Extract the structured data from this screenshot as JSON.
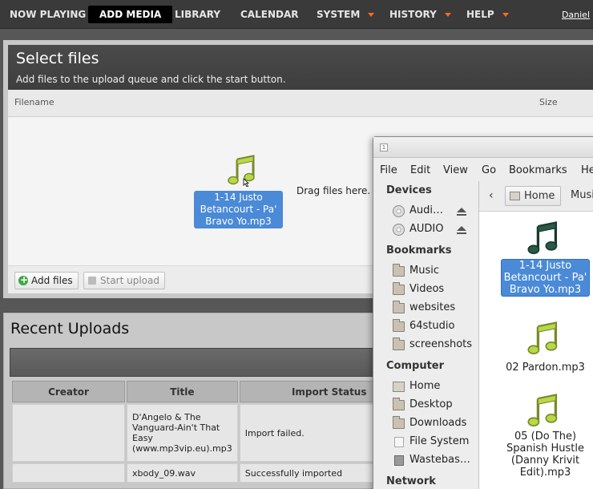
{
  "nav": {
    "items": [
      {
        "label": "NOW PLAYING",
        "dropdown": false
      },
      {
        "label": "ADD MEDIA",
        "dropdown": false,
        "active": true
      },
      {
        "label": "LIBRARY",
        "dropdown": false
      },
      {
        "label": "CALENDAR",
        "dropdown": false
      },
      {
        "label": "SYSTEM",
        "dropdown": true
      },
      {
        "label": "HISTORY",
        "dropdown": true
      },
      {
        "label": "HELP",
        "dropdown": true
      }
    ],
    "user": "Daniel",
    "arrow_color": "#ff6b1a"
  },
  "select_files": {
    "title": "Select files",
    "subtitle": "Add files to the upload queue and click the start button.",
    "col_filename": "Filename",
    "col_size": "Size",
    "drag_hint": "Drag files here.",
    "dragged_file": "1-14 Justo Betancourt - Pa' Bravo Yo.mp3",
    "add_files": "Add files",
    "start_upload": "Start upload"
  },
  "recent": {
    "title": "Recent Uploads",
    "columns": [
      "Creator",
      "Title",
      "Import Status"
    ],
    "rows": [
      {
        "creator": "",
        "title": "D'Angelo & The Vanguard-Ain't That Easy (www.mp3vip.eu).mp3",
        "status": "Import failed."
      },
      {
        "creator": "",
        "title": "xbody_09.wav",
        "status": "Successfully imported"
      }
    ]
  },
  "file_manager": {
    "menu": [
      "File",
      "Edit",
      "View",
      "Go",
      "Bookmarks",
      "He"
    ],
    "sidebar": {
      "devices_heading": "Devices",
      "devices": [
        {
          "label": "Audi…",
          "icon": "disc-icon",
          "eject": true
        },
        {
          "label": "AUDIO",
          "icon": "disc-icon",
          "eject": true
        }
      ],
      "bookmarks_heading": "Bookmarks",
      "bookmarks": [
        {
          "label": "Music",
          "icon": "folder-icon"
        },
        {
          "label": "Videos",
          "icon": "folder-icon"
        },
        {
          "label": "websites",
          "icon": "folder-icon"
        },
        {
          "label": "64studio",
          "icon": "folder-icon"
        },
        {
          "label": "screenshots",
          "icon": "folder-icon"
        }
      ],
      "computer_heading": "Computer",
      "computer": [
        {
          "label": "Home",
          "icon": "home-icon"
        },
        {
          "label": "Desktop",
          "icon": "folder-icon"
        },
        {
          "label": "Downloads",
          "icon": "folder-icon"
        },
        {
          "label": "File System",
          "icon": "drive-icon"
        },
        {
          "label": "Wastebas…",
          "icon": "trash-icon"
        }
      ],
      "network_heading": "Network"
    },
    "path": {
      "back": "‹",
      "home": "Home",
      "current": "Musi"
    },
    "files": [
      {
        "name": "1-14 Justo Betancourt - Pa' Bravo Yo.mp3",
        "selected": true,
        "icon": "music-note-icon"
      },
      {
        "name": "02 Pardon.mp3",
        "selected": false,
        "icon": "music-note-icon"
      },
      {
        "name": "05 (Do The) Spanish Hustle (Danny Krivit Edit).mp3",
        "selected": false,
        "icon": "music-note-icon"
      }
    ]
  },
  "colors": {
    "selection": "#4a8ad6",
    "music_icon_green": "#b8d84a",
    "music_icon_dark": "#2a5a46"
  }
}
